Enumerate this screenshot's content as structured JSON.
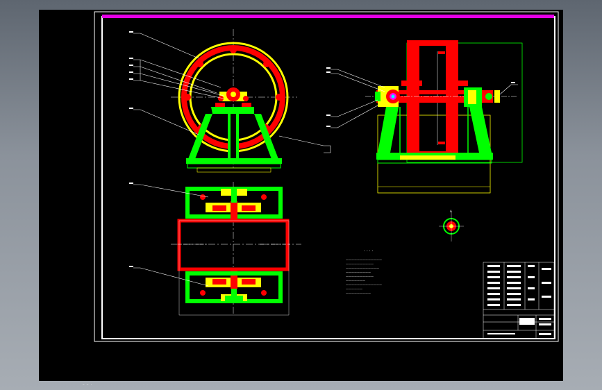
{
  "viewport": {
    "background": "#000000",
    "status_text": "— — ·"
  },
  "drawing": {
    "notes_title": "· · · ·",
    "notes_lines": [
      "—————————————",
      "——————————",
      "————————————",
      "—————————",
      "——————————",
      "———————",
      "—————————————",
      "——————",
      "—————————"
    ],
    "leader_labels": [
      "",
      "",
      "",
      "",
      "",
      "",
      "",
      "",
      "",
      "",
      "",
      "",
      "",
      ""
    ],
    "title_block": {
      "cells": [
        "",
        "",
        "",
        "",
        "",
        "",
        ""
      ]
    }
  },
  "colors": {
    "border": "#ffffff",
    "magenta": "#e600e6",
    "red": "#ff0000",
    "yellow": "#ffff00",
    "green": "#00ff00",
    "cyan": "#00ffff",
    "white": "#ffffff"
  }
}
